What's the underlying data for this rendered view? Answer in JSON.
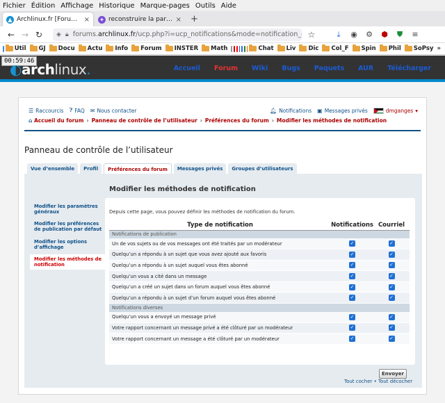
{
  "browser": {
    "menu": [
      "Fichier",
      "Édition",
      "Affichage",
      "Historique",
      "Marque-pages",
      "Outils",
      "Aide"
    ],
    "tabs": [
      {
        "title": "Archlinux.fr [Forums] - Panneau",
        "close": "×"
      },
      {
        "title": "reconstruire la partition EFI",
        "close": "×"
      }
    ],
    "new_tab": "+",
    "url": {
      "prefix": "forums.",
      "host": "archlinux.fr",
      "path": "/ucp.php?i=ucp_notifications&mode=notification_options"
    },
    "bookmarks": [
      "Util",
      "GJ",
      "Docu",
      "Actu",
      "Info",
      "Forum",
      "INSTER",
      "Math",
      "Chat",
      "Liv",
      "Dic",
      "Col_F",
      "Spin",
      "Phil",
      "SoPsy"
    ],
    "more": "»"
  },
  "clock": "00:59:46",
  "arch": {
    "logo_arch": "arch",
    "logo_linux": "linux",
    "logo_dot": ".",
    "nav": [
      "Accueil",
      "Forum",
      "Wiki",
      "Bugs",
      "Paquets",
      "AUR",
      "Télécharger"
    ]
  },
  "forum": {
    "top_left": [
      "Raccourcis",
      "FAQ",
      "Nous contacter"
    ],
    "top_right": {
      "notifications": "Notifications",
      "messages": "Messages privés",
      "user": "dmganges"
    },
    "breadcrumbs": [
      "Accueil du forum",
      "Panneau de contrôle de l’utilisateur",
      "Préférences du forum",
      "Modifier les méthodes de notification"
    ],
    "crumb_sep": "›",
    "ucp_title": "Panneau de contrôle de l’utilisateur",
    "tabs": [
      "Vue d’ensemble",
      "Profil",
      "Préférences du forum",
      "Messages privés",
      "Groupes d’utilisateurs"
    ],
    "side_nav": [
      "Modifier les paramètres généraux",
      "Modifier les préférences de publication par défaut",
      "Modifier les options d’affichage",
      "Modifier les méthodes de notification"
    ],
    "panel_title": "Modifier les méthodes de notification",
    "intro": "Depuis cette page, vous pouvez définir les méthodes de notification du forum.",
    "columns": [
      "Type de notification",
      "Notifications",
      "Courriel"
    ],
    "sections": [
      {
        "name": "Notifications de publication",
        "rows": [
          "Un de vos sujets ou de vos messages ont été traités par un modérateur",
          "Quelqu’un a répondu à un sujet que vous avez ajouté aux favoris",
          "Quelqu’un a répondu à un sujet auquel vous êtes abonné",
          "Quelqu’un vous a cité dans un message",
          "Quelqu’un a créé un sujet dans un forum auquel vous êtes abonné",
          "Quelqu’un a répondu à un sujet d’un forum auquel vous êtes abonné"
        ]
      },
      {
        "name": "Notifications diverses",
        "rows": [
          "Quelqu’un vous a envoyé un message privé",
          "Votre rapport concernant un message privé a été clôturé par un modérateur",
          "Votre rapport concernant un message a été clôturé par un modérateur"
        ]
      }
    ],
    "check_glyph": "✓",
    "submit": "Envoyer",
    "mark_all": "Tout cocher",
    "unmark_all": "Tout décocher",
    "toggle_sep": " • "
  }
}
